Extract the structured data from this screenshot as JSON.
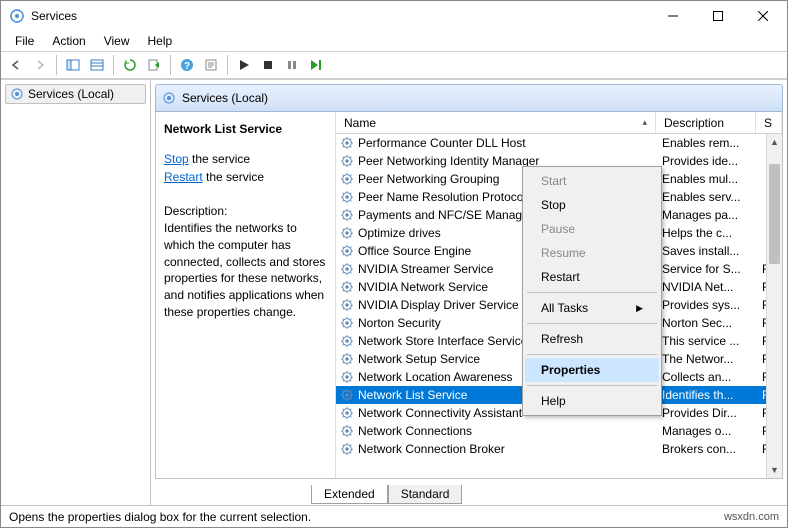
{
  "window": {
    "title": "Services"
  },
  "menu": {
    "file": "File",
    "action": "Action",
    "view": "View",
    "help": "Help"
  },
  "tree": {
    "root": "Services (Local)"
  },
  "right_header": "Services (Local)",
  "info": {
    "title": "Network List Service",
    "stop_link": "Stop",
    "stop_rest": " the service",
    "restart_link": "Restart",
    "restart_rest": " the service",
    "desc_h": "Description:",
    "desc": "Identifies the networks to which the computer has connected, collects and stores properties for these networks, and notifies applications when these properties change."
  },
  "columns": {
    "name": "Name",
    "desc": "Description",
    "s": "S"
  },
  "rows": [
    {
      "name": "Network Connection Broker",
      "desc": "Brokers con...",
      "s": "F",
      "sel": false
    },
    {
      "name": "Network Connections",
      "desc": "Manages o...",
      "s": "F",
      "sel": false
    },
    {
      "name": "Network Connectivity Assistant",
      "desc": "Provides Dir...",
      "s": "F",
      "sel": false
    },
    {
      "name": "Network List Service",
      "desc": "Identifies th...",
      "s": "F",
      "sel": true
    },
    {
      "name": "Network Location Awareness",
      "desc": "Collects an...",
      "s": "F",
      "sel": false
    },
    {
      "name": "Network Setup Service",
      "desc": "The Networ...",
      "s": "F",
      "sel": false
    },
    {
      "name": "Network Store Interface Service",
      "desc": "This service ...",
      "s": "F",
      "sel": false
    },
    {
      "name": "Norton Security",
      "desc": "Norton Sec...",
      "s": "F",
      "sel": false
    },
    {
      "name": "NVIDIA Display Driver Service",
      "desc": "Provides sys...",
      "s": "F",
      "sel": false
    },
    {
      "name": "NVIDIA Network Service",
      "desc": "NVIDIA Net...",
      "s": "F",
      "sel": false
    },
    {
      "name": "NVIDIA Streamer Service",
      "desc": "Service for S...",
      "s": "F",
      "sel": false
    },
    {
      "name": "Office Source Engine",
      "desc": "Saves install...",
      "s": "",
      "sel": false
    },
    {
      "name": "Optimize drives",
      "desc": "Helps the c...",
      "s": "",
      "sel": false
    },
    {
      "name": "Payments and NFC/SE Manager",
      "desc": "Manages pa...",
      "s": "",
      "sel": false
    },
    {
      "name": "Peer Name Resolution Protocol",
      "desc": "Enables serv...",
      "s": "",
      "sel": false
    },
    {
      "name": "Peer Networking Grouping",
      "desc": "Enables mul...",
      "s": "",
      "sel": false
    },
    {
      "name": "Peer Networking Identity Manager",
      "desc": "Provides ide...",
      "s": "",
      "sel": false
    },
    {
      "name": "Performance Counter DLL Host",
      "desc": "Enables rem...",
      "s": "",
      "sel": false
    }
  ],
  "context": {
    "start": "Start",
    "stop": "Stop",
    "pause": "Pause",
    "resume": "Resume",
    "restart": "Restart",
    "all_tasks": "All Tasks",
    "refresh": "Refresh",
    "properties": "Properties",
    "help": "Help"
  },
  "tabs": {
    "extended": "Extended",
    "standard": "Standard"
  },
  "status": "Opens the properties dialog box for the current selection.",
  "footer": "wsxdn.com"
}
